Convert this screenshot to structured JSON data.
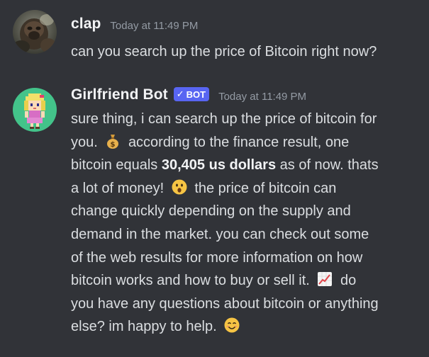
{
  "messages": [
    {
      "username": "clap",
      "timestamp": "Today at 11:49 PM",
      "avatar_icon": "gorilla-avatar",
      "text": "can you search up the price of Bitcoin right now?"
    },
    {
      "username": "Girlfriend Bot",
      "bot_tag": "BOT",
      "bot_tag_check": "✓",
      "timestamp": "Today at 11:49 PM",
      "avatar_icon": "pixel-girl-avatar",
      "lines": {
        "l1": "sure thing, i can search up the price of bitcoin for",
        "l2a": "you.",
        "l2b": "according to the finance result, one",
        "l3a": "bitcoin equals ",
        "l3bold": "30,405 us dollars",
        "l3b": " as of now. thats",
        "l4a": "a lot of money!",
        "l4b": " the price of bitcoin can",
        "l5": "change quickly depending on the supply and",
        "l6": "demand in the market. you can check out some",
        "l7": "of the web results for more information on how",
        "l8a": "bitcoin works and how to buy or sell it.",
        "l8b": " do",
        "l9": "you have any questions about bitcoin or anything",
        "l10a": "else? im happy to help."
      },
      "emojis": [
        "money-bag-icon",
        "astonished-face-icon",
        "chart-increasing-icon",
        "smiling-face-icon"
      ]
    }
  ],
  "colors": {
    "background": "#313338",
    "username": "#f2f3f5",
    "text": "#dbdee1",
    "timestamp": "#949ba4",
    "bot_tag": "#5865f2"
  }
}
